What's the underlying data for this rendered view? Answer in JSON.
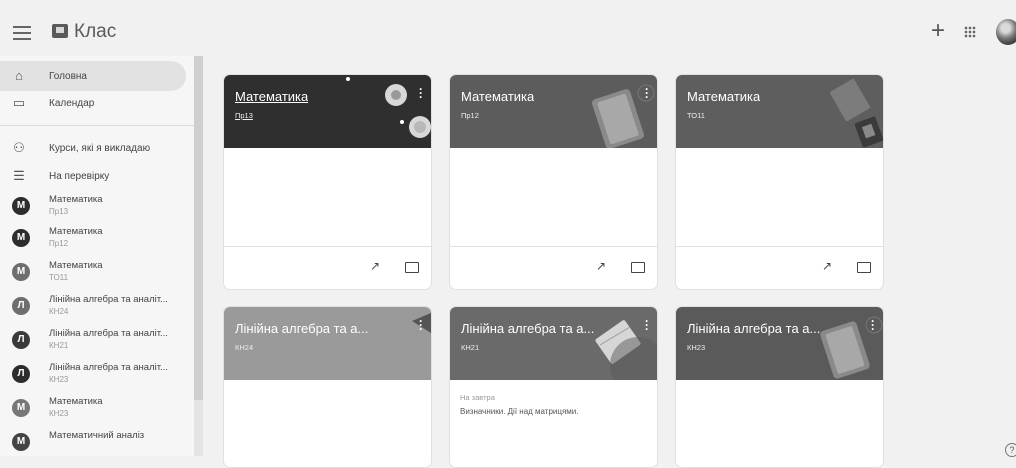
{
  "app": {
    "title": "Клас"
  },
  "header_icons": [
    "menu-icon",
    "classroom-logo-icon",
    "plus-icon",
    "apps-grid-icon",
    "avatar"
  ],
  "sidebar": {
    "nav": [
      {
        "label": "Головна",
        "icon": "home-icon"
      },
      {
        "label": "Календар",
        "icon": "calendar-icon"
      },
      {
        "label": "Курси, які я викладаю",
        "icon": "people-icon"
      },
      {
        "label": "На перевірку",
        "icon": "review-icon"
      }
    ],
    "courses": [
      {
        "letter": "М",
        "name": "Математика",
        "section": "Пр13",
        "color": "#2d2d2d"
      },
      {
        "letter": "М",
        "name": "Математика",
        "section": "Пр12",
        "color": "#2d2d2d"
      },
      {
        "letter": "М",
        "name": "Математика",
        "section": "ТО11",
        "color": "#6e6e6e"
      },
      {
        "letter": "Л",
        "name": "Лінійна алгебра та аналіт...",
        "section": "КН24",
        "color": "#6e6e6e"
      },
      {
        "letter": "Л",
        "name": "Лінійна алгебра та аналіт...",
        "section": "КН21",
        "color": "#3a3a3a"
      },
      {
        "letter": "Л",
        "name": "Лінійна алгебра та аналіт...",
        "section": "КН23",
        "color": "#2d2d2d"
      },
      {
        "letter": "М",
        "name": "Математика",
        "section": "КН23",
        "color": "#777777"
      },
      {
        "letter": "М",
        "name": "Математичний аналіз",
        "section": "",
        "color": "#444444"
      }
    ]
  },
  "cards": [
    {
      "title": "Математика",
      "section": "Пр13",
      "underline": true,
      "bg": "#2f2f2f"
    },
    {
      "title": "Математика",
      "section": "Пр12",
      "underline": false,
      "bg": "#5c5c5c"
    },
    {
      "title": "Математика",
      "section": "ТО11",
      "underline": false,
      "bg": "#5e5e5e"
    },
    {
      "title": "Лінійна алгебра та а...",
      "section": "КН24",
      "underline": false,
      "bg": "#9a9a9a"
    },
    {
      "title": "Лінійна алгебра та а...",
      "section": "КН21",
      "underline": false,
      "bg": "#6a6a6a",
      "due_label": "На завтра",
      "assignment": "Визначники. Дії над матрицями."
    },
    {
      "title": "Лінійна алгебра та а...",
      "section": "КН23",
      "underline": false,
      "bg": "#5a5a5a"
    }
  ]
}
